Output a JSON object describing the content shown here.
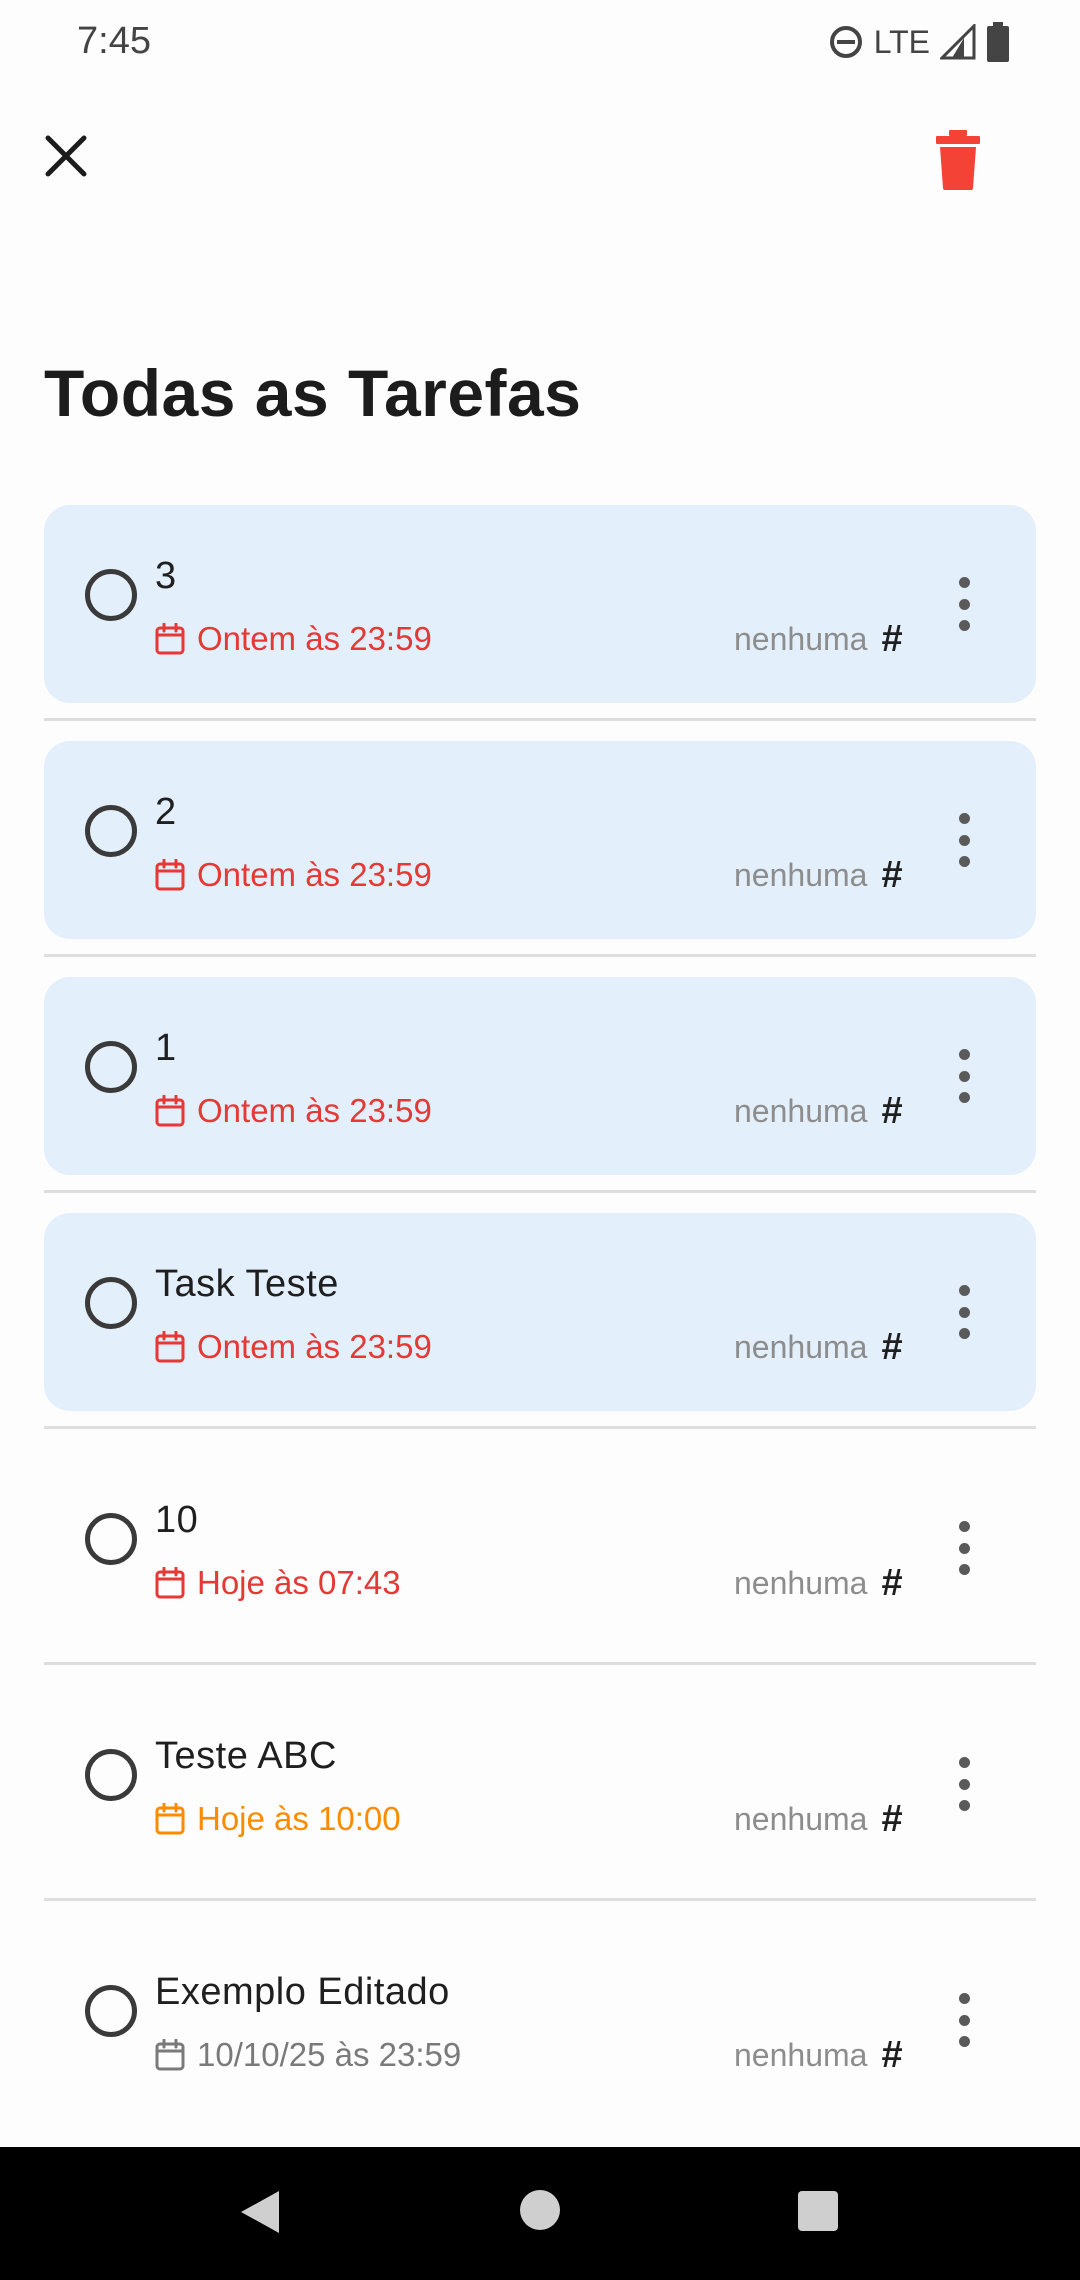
{
  "status_bar": {
    "time": "7:45",
    "network": "LTE"
  },
  "header": {
    "title": "Todas as Tarefas"
  },
  "colors": {
    "overdue": "#e53935",
    "today_later": "#fb8c00",
    "normal": "#7a7a7a",
    "overdue_bg": "#e3effb",
    "trash": "#f44336"
  },
  "tasks": [
    {
      "title": "3",
      "date": "Ontem às 23:59",
      "tag": "nenhuma",
      "hash": "#",
      "state": "overdue"
    },
    {
      "title": "2",
      "date": "Ontem às 23:59",
      "tag": "nenhuma",
      "hash": "#",
      "state": "overdue"
    },
    {
      "title": "1",
      "date": "Ontem às 23:59",
      "tag": "nenhuma",
      "hash": "#",
      "state": "overdue"
    },
    {
      "title": "Task Teste",
      "date": "Ontem às 23:59",
      "tag": "nenhuma",
      "hash": "#",
      "state": "overdue"
    },
    {
      "title": "10",
      "date": "Hoje às 07:43",
      "tag": "nenhuma",
      "hash": "#",
      "state": "today-due"
    },
    {
      "title": "Teste ABC",
      "date": "Hoje às 10:00",
      "tag": "nenhuma",
      "hash": "#",
      "state": "today-later"
    },
    {
      "title": "Exemplo Editado",
      "date": "10/10/25 às 23:59",
      "tag": "nenhuma",
      "hash": "#",
      "state": "normal"
    }
  ]
}
